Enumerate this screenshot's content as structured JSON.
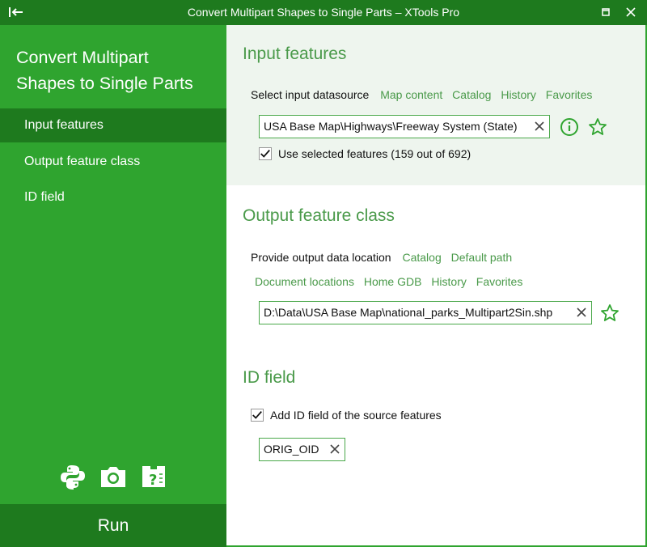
{
  "window": {
    "title": "Convert Multipart Shapes to Single Parts – XTools Pro"
  },
  "sidebar": {
    "title_line1": "Convert Multipart",
    "title_line2": "Shapes to Single Parts",
    "items": [
      {
        "label": "Input features"
      },
      {
        "label": "Output feature class"
      },
      {
        "label": "ID field"
      }
    ],
    "run_label": "Run"
  },
  "input": {
    "title": "Input features",
    "select_label": "Select input datasource",
    "links": [
      "Map content",
      "Catalog",
      "History",
      "Favorites"
    ],
    "value": "USA Base Map\\Highways\\Freeway System (State)",
    "use_selected_label": "Use selected features (159 out of 692)",
    "use_selected_checked": true
  },
  "output": {
    "title": "Output feature class",
    "provide_label": "Provide output data location",
    "links_row1": [
      "Catalog",
      "Default path"
    ],
    "links_row2": [
      "Document locations",
      "Home GDB",
      "History",
      "Favorites"
    ],
    "value": "D:\\Data\\USA Base Map\\national_parks_Multipart2Sin.shp"
  },
  "idfield": {
    "title": "ID field",
    "add_label": "Add ID field of the source features",
    "add_checked": true,
    "value": "ORIG_OID"
  },
  "colors": {
    "sidebar": "#2fa42f",
    "sidebar_active": "#1e7a1e",
    "accent_text": "#4a9a4a",
    "input_section_bg": "#eef5ee"
  }
}
